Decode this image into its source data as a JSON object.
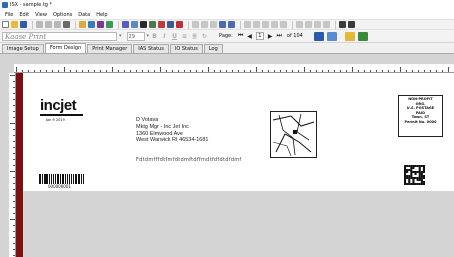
{
  "window": {
    "title": "ISX - sample.tg *"
  },
  "menu": [
    "File",
    "Edit",
    "View",
    "Options",
    "Data",
    "Help"
  ],
  "format_bar": {
    "font_name": "Kaase Print",
    "font_size": "29",
    "page_label": "Page:",
    "page_current": "1",
    "page_of": "of 104"
  },
  "tabs": [
    {
      "label": "Image Setup",
      "active": false
    },
    {
      "label": "Form Design",
      "active": true
    },
    {
      "label": "Print Manager",
      "active": false
    },
    {
      "label": "IAS Status",
      "active": false
    },
    {
      "label": "IO Status",
      "active": false
    },
    {
      "label": "Log",
      "active": false
    }
  ],
  "document": {
    "logo_text": "incjet",
    "job_date": "Jan 9 2019",
    "address_lines": [
      "D Votava",
      "Mktg Mgr - Inc Jet Inc",
      "1360 Elmwood Ave",
      "West Warwick RI 46534-1681"
    ],
    "imb_barcode_text": "Fdtdmfffdtfmfdtdmftdffmdtfdfdtdfdmf",
    "indicia_lines": [
      "NON-PROFIT",
      "ORG.",
      "U.S. POSTAGE",
      "PAID",
      "Town, ST",
      "Permit No. 0000"
    ],
    "barcode_number": "000000001"
  },
  "colors": {
    "accent_bar": "#7a1010",
    "workspace": "#d4d4d4"
  }
}
